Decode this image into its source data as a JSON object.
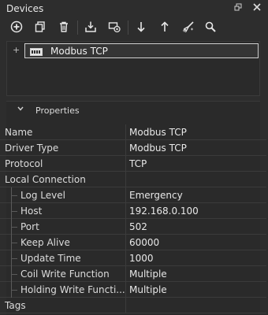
{
  "panel": {
    "title": "Devices",
    "float_icon": "restore-icon",
    "close_icon": "close-icon"
  },
  "toolbar": {
    "items": [
      {
        "name": "add-device-button",
        "icon": "plus-circle-icon"
      },
      {
        "name": "duplicate-button",
        "icon": "copy-icon"
      },
      {
        "name": "delete-button",
        "icon": "trash-icon"
      },
      {
        "name": "import-button",
        "icon": "download-tray-icon"
      },
      {
        "name": "connect-button",
        "icon": "device-settings-icon"
      },
      {
        "name": "move-down-button",
        "icon": "arrow-down-icon"
      },
      {
        "name": "move-up-button",
        "icon": "arrow-up-icon"
      },
      {
        "name": "clear-button",
        "icon": "broom-icon"
      },
      {
        "name": "search-button",
        "icon": "search-icon"
      }
    ]
  },
  "tree": {
    "expander": "+",
    "node_label": "Modbus TCP"
  },
  "properties": {
    "header": "Properties",
    "rows": [
      {
        "key": "Name",
        "value": "Modbus TCP",
        "child": false
      },
      {
        "key": "Driver Type",
        "value": "Modbus TCP",
        "child": false
      },
      {
        "key": "Protocol",
        "value": "TCP",
        "child": false
      },
      {
        "key": "Local Connection",
        "value": "",
        "child": false
      },
      {
        "key": "Log Level",
        "value": "Emergency",
        "child": true
      },
      {
        "key": "Host",
        "value": "192.168.0.100",
        "child": true
      },
      {
        "key": "Port",
        "value": "502",
        "child": true
      },
      {
        "key": "Keep Alive",
        "value": "60000",
        "child": true
      },
      {
        "key": "Update Time",
        "value": "1000",
        "child": true
      },
      {
        "key": "Coil Write Function",
        "value": "Multiple",
        "child": true
      },
      {
        "key": "Holding Write Functi...",
        "value": "Multiple",
        "child": true
      },
      {
        "key": "Tags",
        "value": "",
        "child": false
      }
    ]
  }
}
